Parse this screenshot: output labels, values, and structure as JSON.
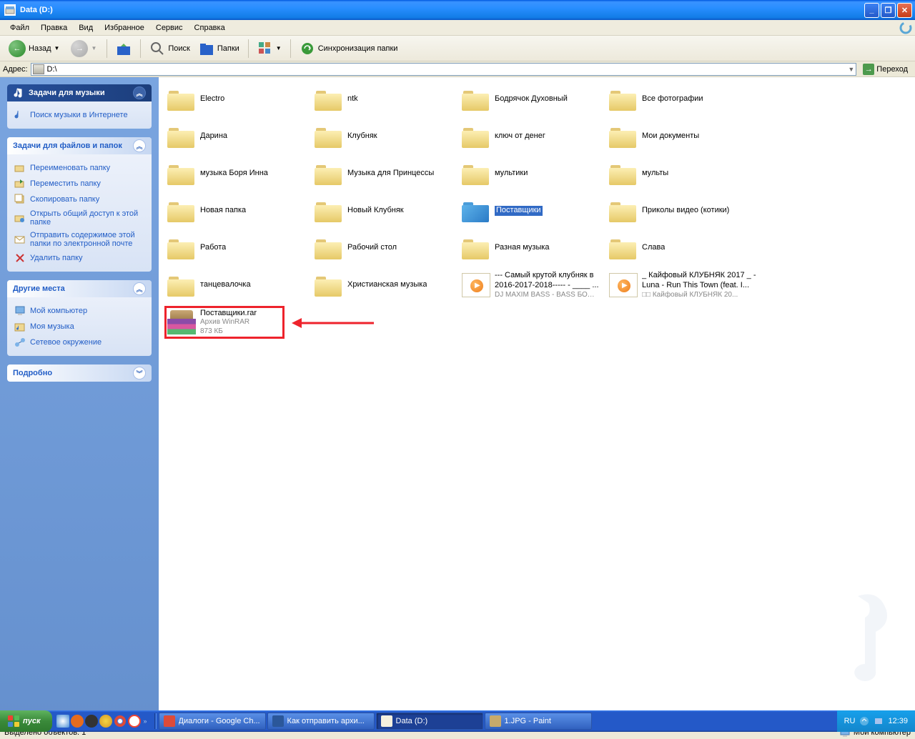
{
  "window": {
    "title": "Data (D:)"
  },
  "menu": {
    "file": "Файл",
    "edit": "Правка",
    "view": "Вид",
    "favorites": "Избранное",
    "service": "Сервис",
    "help": "Справка"
  },
  "toolbar": {
    "back": "Назад",
    "search": "Поиск",
    "folders": "Папки",
    "sync": "Синхронизация папки"
  },
  "address": {
    "label": "Адрес:",
    "value": "D:\\",
    "go": "Переход"
  },
  "sidebar": {
    "panel1": {
      "title": "Задачи для музыки",
      "link1": "Поиск музыки в Интернете"
    },
    "panel2": {
      "title": "Задачи для файлов и папок",
      "rename": "Переименовать папку",
      "move": "Переместить папку",
      "copy": "Скопировать папку",
      "share": "Открыть общий доступ к этой папке",
      "email": "Отправить содержимое этой папки по электронной почте",
      "delete": "Удалить папку"
    },
    "panel3": {
      "title": "Другие места",
      "mycomp": "Мой компьютер",
      "mymusic": "Моя музыка",
      "network": "Сетевое окружение"
    },
    "panel4": {
      "title": "Подробно"
    }
  },
  "files": [
    {
      "type": "folder",
      "name": "Electro"
    },
    {
      "type": "folder",
      "name": "ntk"
    },
    {
      "type": "folder",
      "name": "Бодрячок Духовный"
    },
    {
      "type": "folder",
      "name": "Все фотографии"
    },
    {
      "type": "folder",
      "name": "Дарина"
    },
    {
      "type": "folder",
      "name": "Клубняк"
    },
    {
      "type": "folder",
      "name": "ключ от денег"
    },
    {
      "type": "folder",
      "name": "Мои документы"
    },
    {
      "type": "folder",
      "name": "музыка Боря Инна"
    },
    {
      "type": "folder",
      "name": "Музыка для Принцессы"
    },
    {
      "type": "folder",
      "name": "мультики"
    },
    {
      "type": "folder",
      "name": "мульты"
    },
    {
      "type": "folder",
      "name": "Новая папка"
    },
    {
      "type": "folder",
      "name": "Новый Клубняк"
    },
    {
      "type": "folder",
      "name": "Поставщики",
      "selected": true
    },
    {
      "type": "folder",
      "name": "Приколы видео (котики)"
    },
    {
      "type": "folder",
      "name": "Работа"
    },
    {
      "type": "folder",
      "name": "Рабочий стол"
    },
    {
      "type": "folder",
      "name": "Разная музыка"
    },
    {
      "type": "folder",
      "name": "Слава"
    },
    {
      "type": "folder",
      "name": "танцевалочка"
    },
    {
      "type": "folder",
      "name": "Христианская музыка"
    },
    {
      "type": "media",
      "name": "--- Самый крутой клубняк в 2016-2017-2018----- - ____ ...",
      "sub": "DJ MAXIM BASS - BASS БОЧК..."
    },
    {
      "type": "media",
      "name": "_ Кайфовый КЛУБНЯК 2017 _ - Luna - Run This Town (feat. I...",
      "sub": "□□ Кайфовый КЛУБНЯК 20..."
    },
    {
      "type": "rar",
      "name": "Поставщики.rar",
      "sub1": "Архив WinRAR",
      "sub2": "873 КБ"
    }
  ],
  "statusbar": {
    "left": "Выделено объектов: 1",
    "right": "Мой компьютер"
  },
  "taskbar": {
    "start": "пуск",
    "tasks": [
      {
        "label": "Диалоги - Google Ch...",
        "icon": "#dd4b39"
      },
      {
        "label": "Как отправить архи...",
        "icon": "#2b579a"
      },
      {
        "label": "Data (D:)",
        "icon": "#f5f0de",
        "active": true
      },
      {
        "label": "1.JPG - Paint",
        "icon": "#c7aa6b"
      }
    ],
    "lang": "RU",
    "time": "12:39"
  }
}
